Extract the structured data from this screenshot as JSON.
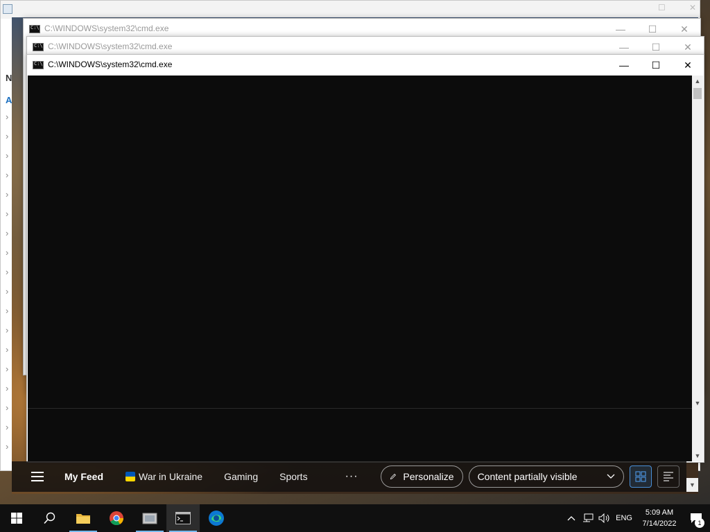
{
  "background_app": {
    "side_letters": [
      "N",
      "A"
    ]
  },
  "windows": [
    {
      "title": "C:\\WINDOWS\\system32\\cmd.exe",
      "state": "inactive"
    },
    {
      "title": "C:\\WINDOWS\\system32\\cmd.exe",
      "state": "inactive"
    },
    {
      "title": "C:\\WINDOWS\\system32\\cmd.exe",
      "state": "active"
    }
  ],
  "window_controls": {
    "minimize": "—",
    "maximize": "☐",
    "close": "✕"
  },
  "feed": {
    "tabs": [
      {
        "label": "My Feed",
        "selected": true
      },
      {
        "label": "War in Ukraine",
        "icon": "ukraine-flag-icon"
      },
      {
        "label": "Gaming"
      },
      {
        "label": "Sports"
      }
    ],
    "more": "···",
    "personalize_label": "Personalize",
    "content_label": "Content partially visible",
    "accent": "#4a90d9"
  },
  "taskbar": {
    "apps": [
      "start",
      "search",
      "file-explorer",
      "chrome",
      "app",
      "cmd",
      "edge"
    ],
    "language": "ENG",
    "time": "5:09 AM",
    "date": "7/14/2022",
    "notification_count": "1"
  }
}
